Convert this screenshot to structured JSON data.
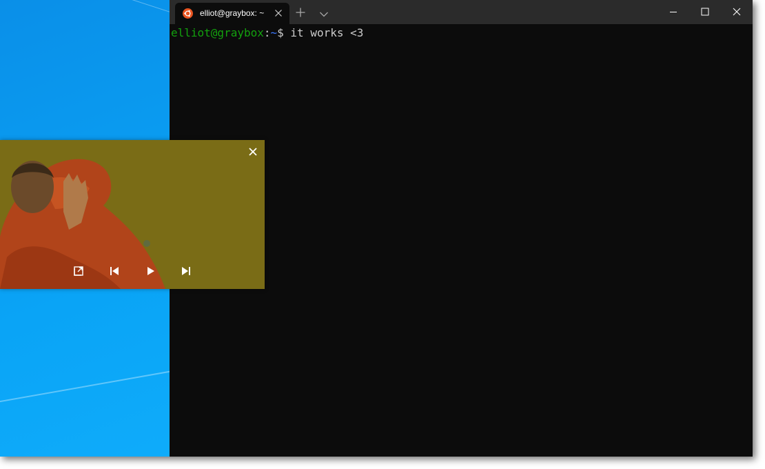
{
  "terminal": {
    "tab": {
      "title": "elliot@graybox: ~",
      "icon": "ubuntu-logo-icon",
      "icon_color": "#e95420"
    },
    "buttons": {
      "new_tab": "plus-icon",
      "dropdown": "chevron-down-icon",
      "minimize": "minimize-icon",
      "maximize": "maximize-icon",
      "close": "close-icon"
    },
    "prompt": {
      "user_host": "elliot@graybox",
      "separator": ":",
      "path": "~",
      "symbol": "$",
      "command": " it works <3"
    },
    "colors": {
      "background": "#0c0c0c",
      "titlebar": "#2b2b2b",
      "user_host": "#13a10e",
      "path": "#3b78ff",
      "text": "#cccccc"
    }
  },
  "pip_player": {
    "controls": {
      "close": "close-icon",
      "pop_out": "open-external-icon",
      "previous": "skip-previous-icon",
      "play": "play-icon",
      "next": "skip-next-icon"
    },
    "tint_color": "#7a6c16"
  },
  "desktop": {
    "background_color": "#0aa4f6"
  }
}
